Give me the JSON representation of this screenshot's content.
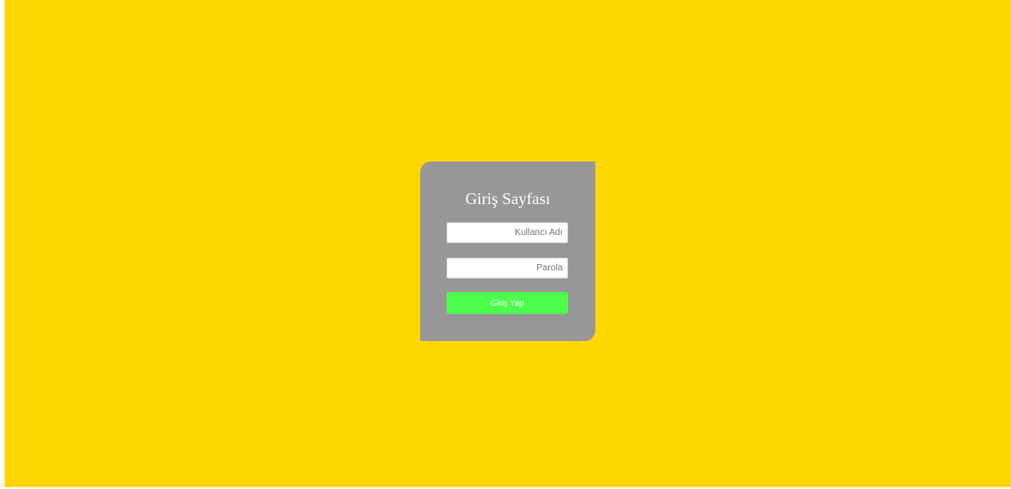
{
  "page": {
    "title": "Giriş Sayfası"
  },
  "form": {
    "username_placeholder": "Kullancı Adı",
    "username_value": "",
    "password_placeholder": "Parola",
    "password_value": "",
    "submit_label": "Giriş Yap"
  },
  "colors": {
    "background": "#FFD700",
    "card": "#979797",
    "submit_button": "#4CFF4C",
    "title_text": "#FFFFFF"
  }
}
